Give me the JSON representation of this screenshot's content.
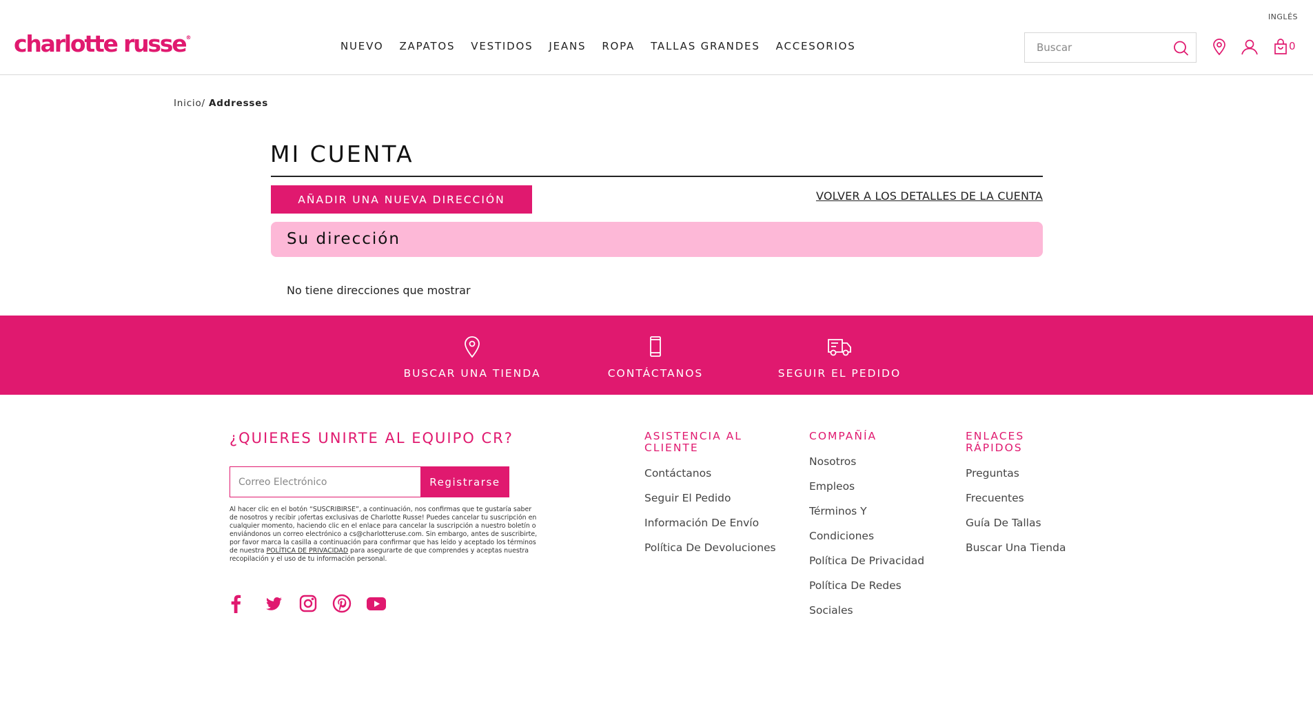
{
  "header": {
    "language": "INGLÉS",
    "logo_text": "charlotte russe",
    "logo_mark": "®",
    "nav": [
      "NUEVO",
      "ZAPATOS",
      "VESTIDOS",
      "JEANS",
      "ROPA",
      "TALLAS GRANDES",
      "ACCESORIOS"
    ],
    "search_placeholder": "Buscar",
    "cart_count": "0"
  },
  "breadcrumb": {
    "home": "Inicio",
    "separator": "/",
    "current": "Addresses"
  },
  "account": {
    "title": "MI CUENTA",
    "add_button": "AÑADIR UNA NUEVA DIRECCIÓN",
    "back_link": "VOLVER A LOS DETALLES DE LA CUENTA",
    "address_heading": "Su dirección",
    "empty_message": "No tiene direcciones que mostrar"
  },
  "band": {
    "store": "BUSCAR UNA TIENDA",
    "contact": "CONTÁCTANOS",
    "track": "SEGUIR EL PEDIDO"
  },
  "footer": {
    "newsletter_title": "¿QUIERES UNIRTE AL EQUIPO CR?",
    "email_placeholder": "Correo Electrónico",
    "register_button": "Registrarse",
    "legal_text": "Al hacer clic en el botón “SUSCRIBIRSE”, a continuación, nos confirmas que te gustaría saber de nosotros y recibir ¡ofertas exclusivas de Charlotte Russe! Puedes cancelar tu suscripción en cualquier momento, haciendo clic en el enlace para cancelar la suscripción a nuestro boletín o enviándonos un correo electrónico a cs@charlotteruse.com. Sin embargo, antes de suscribirte, por favor marca la casilla a continuación para confirmar que has leído y aceptado los términos de nuestra ",
    "legal_link": "POLÍTICA DE PRIVACIDAD",
    "legal_text_end": " para asegurarte de que comprendes y aceptas nuestra recopilación y el uso de tu información personal.",
    "columns": {
      "support": {
        "title": "ASISTENCIA AL CLIENTE",
        "links": [
          "Contáctanos",
          "Seguir El Pedido",
          "Información De Envío",
          "Política De Devoluciones"
        ]
      },
      "company": {
        "title": "COMPAÑÍA",
        "links": [
          "Nosotros",
          "Empleos",
          "Términos Y",
          "Condiciones",
          "Política De Privacidad",
          "Política De Redes",
          "Sociales"
        ]
      },
      "quick": {
        "title": "ENLACES RÁPIDOS",
        "links": [
          "Preguntas",
          "Frecuentes",
          "Guía De Tallas",
          "Buscar Una Tienda"
        ]
      }
    },
    "socials": [
      "facebook-icon",
      "twitter-icon",
      "instagram-icon",
      "pinterest-icon",
      "youtube-icon"
    ]
  },
  "colors": {
    "brand": "#e0196f",
    "address_bg": "#fdb8d7"
  }
}
